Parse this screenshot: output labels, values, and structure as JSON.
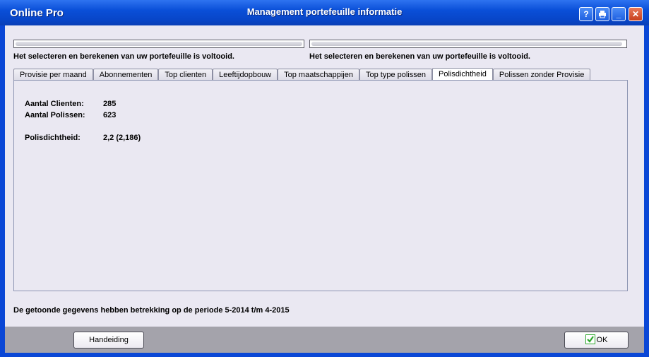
{
  "window": {
    "app_name": "Online Pro",
    "title": "Management portefeuille informatie",
    "buttons": {
      "help": "?",
      "minimize": "_",
      "close": "✕"
    }
  },
  "progress": [
    {
      "text": "Het selecteren en berekenen van uw portefeuille is voltooid.",
      "percent": 100
    },
    {
      "text": "Het selecteren en berekenen van uw portefeuille is voltooid.",
      "percent": 100
    }
  ],
  "tabs": [
    {
      "label": "Provisie per maand",
      "active": false
    },
    {
      "label": "Abonnementen",
      "active": false
    },
    {
      "label": "Top clienten",
      "active": false
    },
    {
      "label": "Leeftijdopbouw",
      "active": false
    },
    {
      "label": "Top maatschappijen",
      "active": false
    },
    {
      "label": "Top type polissen",
      "active": false
    },
    {
      "label": "Polisdichtheid",
      "active": true
    },
    {
      "label": "Polissen zonder Provisie",
      "active": false
    }
  ],
  "panel": {
    "clients_label": "Aantal Clienten:",
    "clients_value": "285",
    "policies_label": "Aantal Polissen:",
    "policies_value": "623",
    "density_label": "Polisdichtheid:",
    "density_value": "2,2  (2,186)"
  },
  "period_text": "De getoonde gegevens hebben betrekking op de periode 5-2014 t/m 4-2015",
  "footer": {
    "manual_button": "Handeiding",
    "ok_button": "OK"
  },
  "colors": {
    "titlebar": "#0a4fd8",
    "client_bg": "#eae8f2",
    "footer_bg": "#a4a3ab",
    "ok_check": "#2ea82e"
  }
}
